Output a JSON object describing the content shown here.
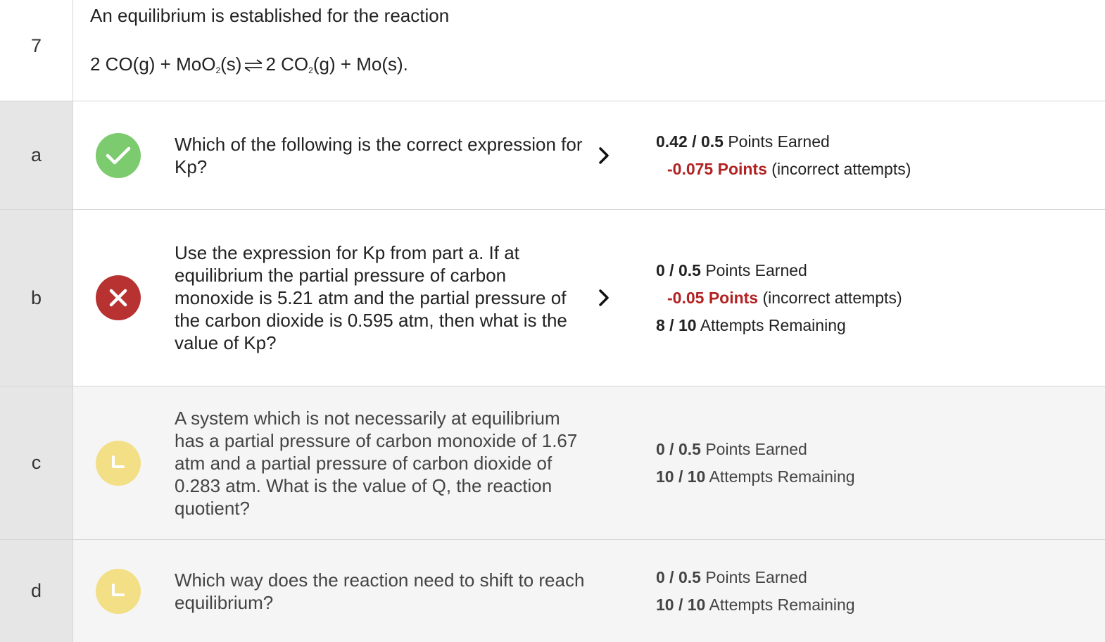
{
  "problem": {
    "number": "7",
    "intro": "An equilibrium is established for the reaction",
    "equation": {
      "part1": "2 CO(g) + MoO",
      "sub1": "2",
      "part2": "(s)",
      "part3": "2 CO",
      "sub2": "2",
      "part4": "(g) + Mo(s)."
    }
  },
  "colors": {
    "correct": "#7ccb6e",
    "incorrect": "#b83232",
    "pending": "#f2df86",
    "penalty_text": "#b22222"
  },
  "parts": [
    {
      "label": "a",
      "status": "correct",
      "status_icon": "check-circle-icon",
      "question": "Which of the following is the correct expression for Kp?",
      "has_chevron": true,
      "earned": "0.42",
      "possible": "0.5",
      "earned_suffix": "Points Earned",
      "penalty": "-0.075 Points",
      "penalty_suffix": "(incorrect attempts)"
    },
    {
      "label": "b",
      "status": "incorrect",
      "status_icon": "x-circle-icon",
      "question": "Use the expression for Kp from part a. If at equilibrium the partial pressure of carbon monoxide is 5.21 atm and the partial pressure of the carbon dioxide is 0.595 atm, then what is the value of Kp?",
      "has_chevron": true,
      "earned": "0",
      "possible": "0.5",
      "earned_suffix": "Points Earned",
      "penalty": "-0.05 Points",
      "penalty_suffix": "(incorrect attempts)",
      "attempts_left": "8",
      "attempts_total": "10",
      "attempts_suffix": "Attempts Remaining"
    },
    {
      "label": "c",
      "status": "pending",
      "status_icon": "clock-circle-icon",
      "question": "A system which is not necessarily at equilibrium has a partial pressure of carbon monoxide of 1.67 atm and a partial pressure of carbon dioxide of 0.283 atm. What is the value of Q, the reaction quotient?",
      "has_chevron": false,
      "earned": "0",
      "possible": "0.5",
      "earned_suffix": "Points Earned",
      "attempts_left": "10",
      "attempts_total": "10",
      "attempts_suffix": "Attempts Remaining"
    },
    {
      "label": "d",
      "status": "pending",
      "status_icon": "clock-circle-icon",
      "question": "Which way does the reaction need to shift to reach equilibrium?",
      "has_chevron": false,
      "earned": "0",
      "possible": "0.5",
      "earned_suffix": "Points Earned",
      "attempts_left": "10",
      "attempts_total": "10",
      "attempts_suffix": "Attempts Remaining"
    }
  ]
}
